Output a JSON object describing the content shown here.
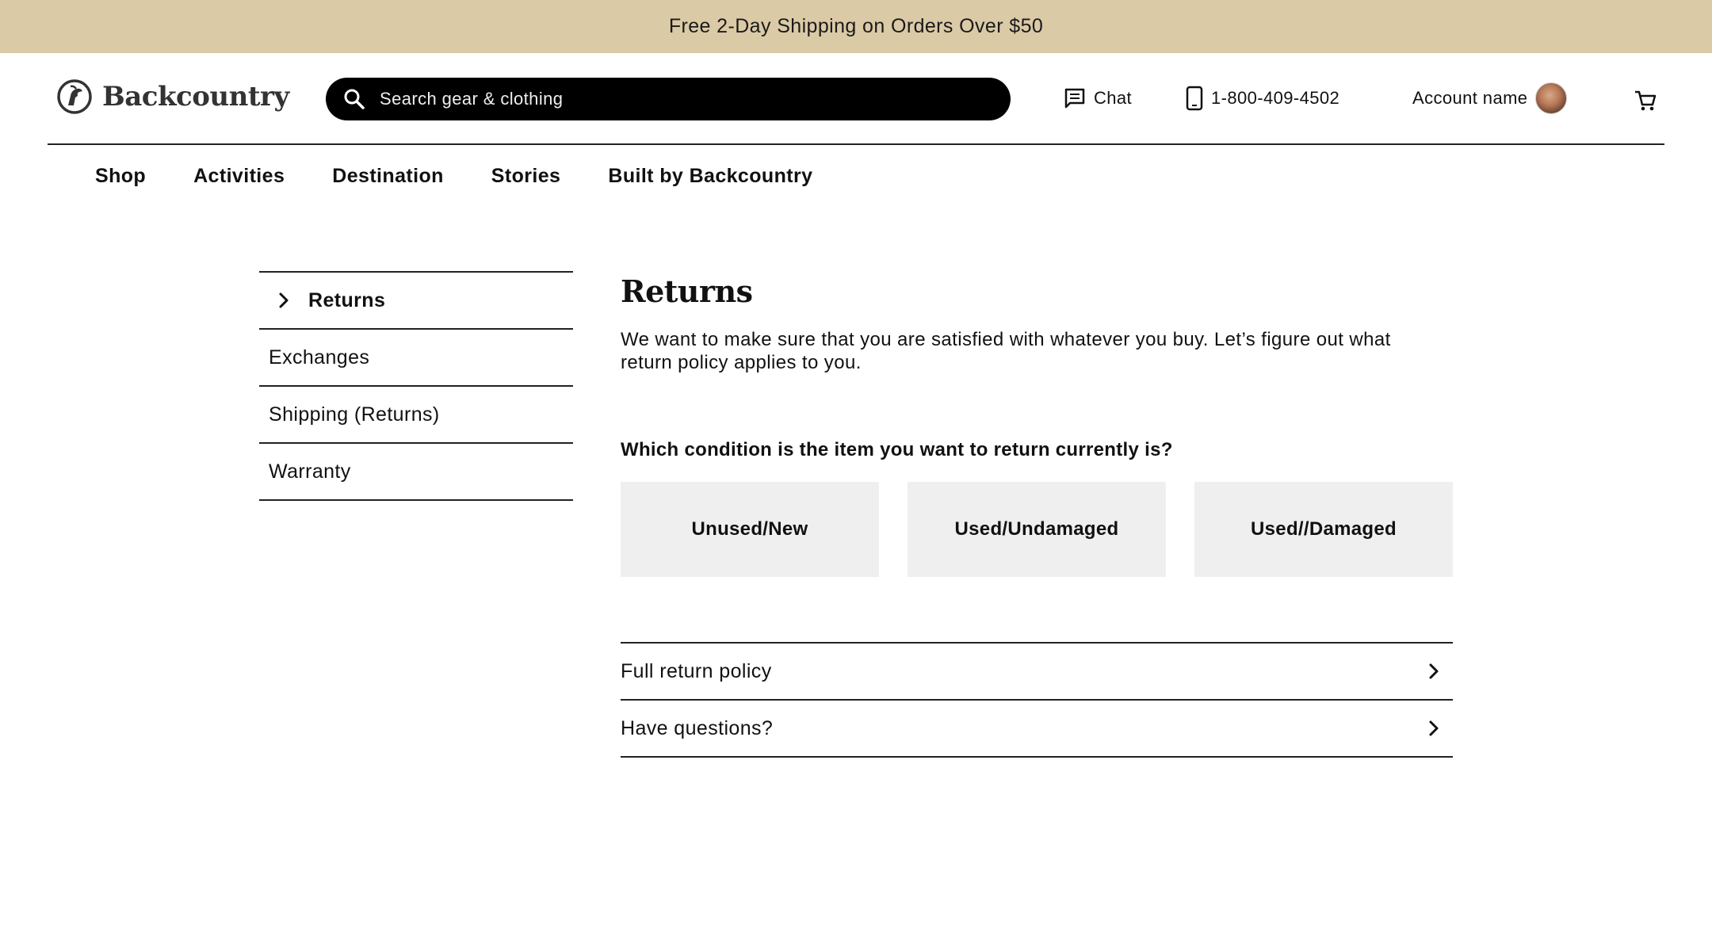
{
  "promo": {
    "text": "Free 2-Day Shipping on Orders Over $50"
  },
  "header": {
    "logo_text": "Backcountry",
    "search_placeholder": "Search gear & clothing",
    "chat_label": "Chat",
    "phone": "1-800-409-4502",
    "account_label": "Account name"
  },
  "nav": {
    "items": [
      {
        "label": "Shop"
      },
      {
        "label": "Activities"
      },
      {
        "label": "Destination"
      },
      {
        "label": "Stories"
      },
      {
        "label": "Built by Backcountry"
      }
    ]
  },
  "sidebar": {
    "items": [
      {
        "label": "Returns",
        "active": true
      },
      {
        "label": "Exchanges"
      },
      {
        "label": "Shipping (Returns)"
      },
      {
        "label": "Warranty"
      }
    ]
  },
  "main": {
    "title": "Returns",
    "intro": "We want to make sure that you are satisfied with whatever you buy. Let’s figure out what return policy applies to you.",
    "question": "Which condition is the item you want to return currently is?",
    "options": [
      {
        "label": "Unused/New"
      },
      {
        "label": "Used/Undamaged"
      },
      {
        "label": "Used//Damaged"
      }
    ],
    "accordion": [
      {
        "label": "Full return policy"
      },
      {
        "label": "Have questions?"
      }
    ]
  },
  "icons": {
    "logo": "goat-logo-icon",
    "search": "search-icon",
    "chat": "chat-icon",
    "phone": "phone-icon",
    "cart": "cart-icon",
    "chevron": "chevron-right-icon"
  },
  "colors": {
    "promo_bg": "#dbcaa6",
    "search_bg": "#000000",
    "option_bg": "#efefef"
  }
}
